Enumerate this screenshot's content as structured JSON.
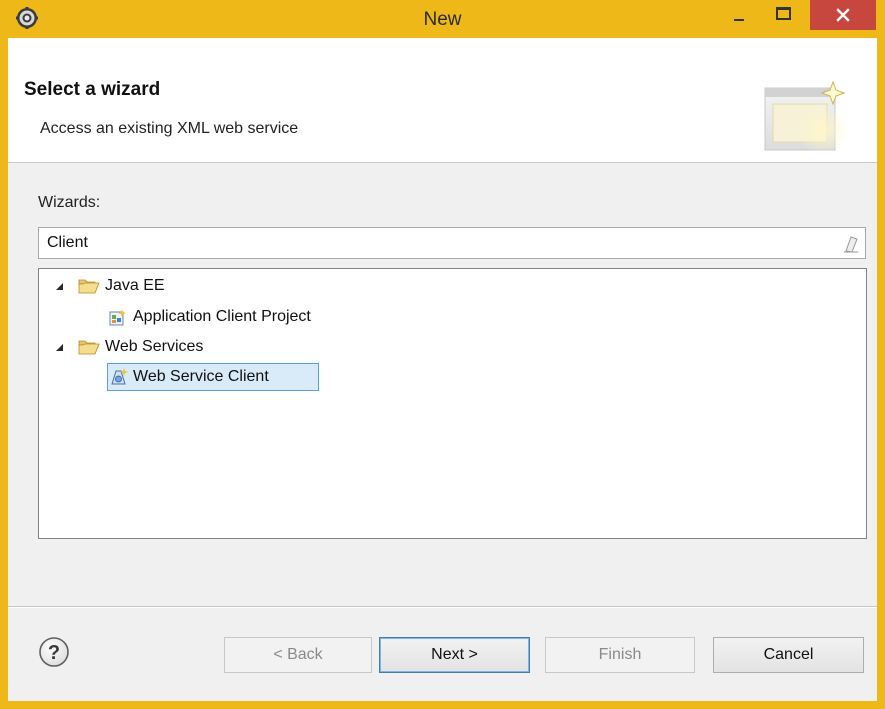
{
  "window": {
    "title": "New",
    "app_icon": "eclipse-gear-icon",
    "title_color": "#eeb819",
    "close_color": "#c7463d"
  },
  "header": {
    "title": "Select a wizard",
    "description": "Access an existing XML web service",
    "banner_icon": "new-wizard-banner-icon"
  },
  "wizards": {
    "label": "Wizards:",
    "filter_value": "Client",
    "clear_icon": "eraser-icon"
  },
  "tree": {
    "categories": [
      {
        "label": "Java EE",
        "expanded": true,
        "items": [
          {
            "label": "Application Client Project",
            "icon": "application-client-project-icon",
            "selected": false
          }
        ]
      },
      {
        "label": "Web Services",
        "expanded": true,
        "items": [
          {
            "label": "Web Service Client",
            "icon": "web-service-client-icon",
            "selected": true
          }
        ]
      }
    ]
  },
  "footer": {
    "help_icon": "help-icon",
    "back_label": "< Back",
    "next_label": "Next >",
    "finish_label": "Finish",
    "cancel_label": "Cancel"
  }
}
